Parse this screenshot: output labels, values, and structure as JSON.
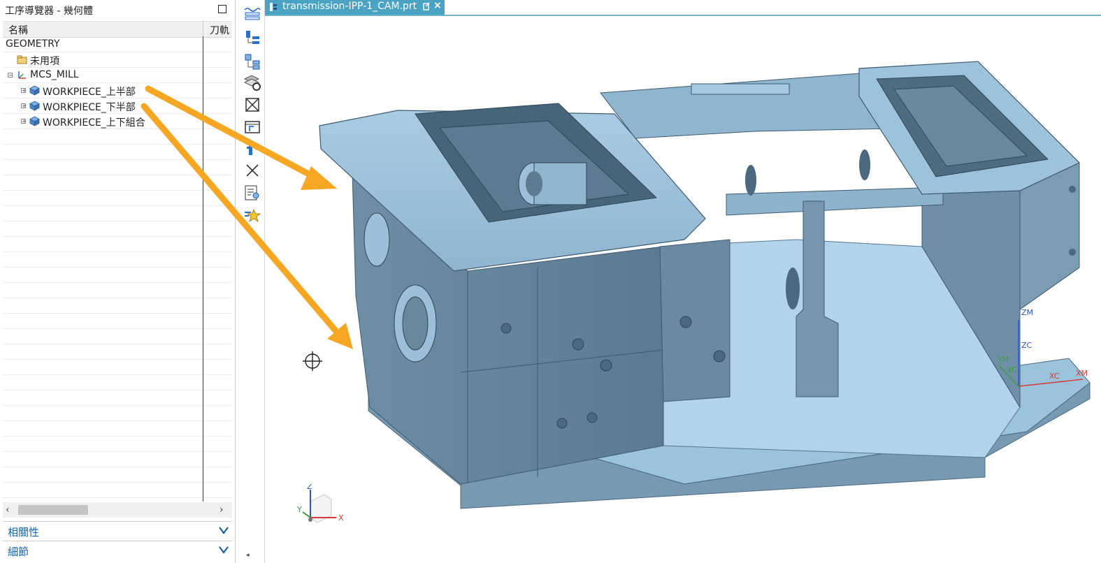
{
  "navigator": {
    "title": "工序導覽器 - 幾何體",
    "columns": {
      "name": "名稱",
      "toolpath": "刀軌"
    },
    "tree": [
      {
        "label": "GEOMETRY",
        "icon": "none"
      },
      {
        "label": "未用項",
        "icon": "folder-icon"
      },
      {
        "label": "MCS_MILL",
        "icon": "mcs-icon"
      },
      {
        "label": "WORKPIECE_上半部",
        "icon": "workpiece-icon"
      },
      {
        "label": "WORKPIECE_下半部",
        "icon": "workpiece-icon"
      },
      {
        "label": "WORKPIECE_上下組合",
        "icon": "workpiece-icon"
      }
    ],
    "sections": [
      {
        "label": "相關性"
      },
      {
        "label": "細節"
      }
    ]
  },
  "toolbar": {
    "icons": [
      "program-order-view-icon",
      "machine-tool-view-icon",
      "geometry-view-icon",
      "machining-method-view-icon",
      "delete-icon",
      "export-icon",
      "filter-icon",
      "close-x-icon",
      "operation-list-icon",
      "favorites-icon"
    ]
  },
  "tab": {
    "label": "transmission-IPP-1_CAM.prt",
    "close": "×"
  },
  "viewport": {
    "model": "transmission housing part",
    "wcs_labels": {
      "zm": "ZM",
      "zc": "ZC",
      "ym": "YM",
      "yc": "YC",
      "xc": "XC",
      "xm": "XM"
    },
    "triad_labels": {
      "z": "Z",
      "y": "Y",
      "x": "X"
    }
  },
  "colors": {
    "tab": "#4ba3c3",
    "part_face": "#9fc4dc",
    "part_dark": "#66879f",
    "arrow": "#f5a623",
    "section_title": "#1a63a8"
  }
}
